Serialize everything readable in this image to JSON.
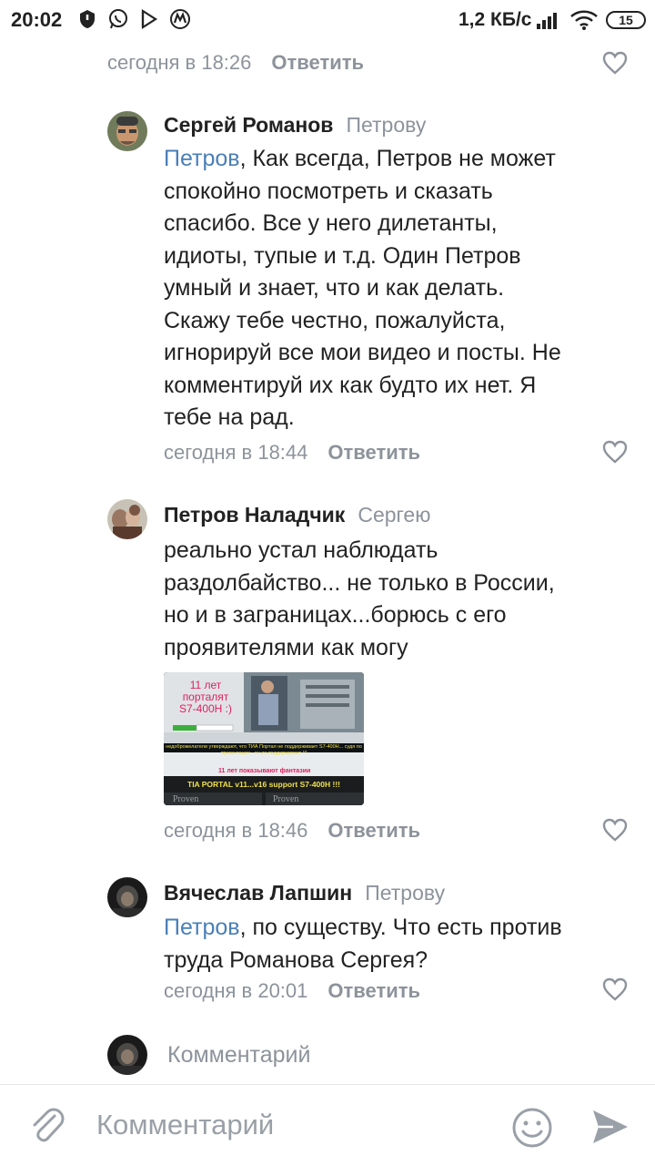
{
  "status_bar": {
    "time": "20:02",
    "net_speed": "1,2 КБ/с",
    "battery": "15"
  },
  "comments": [
    {
      "date": "сегодня в 18:26",
      "reply_label": "Ответить"
    },
    {
      "author": "Сергей Романов",
      "reply_to": "Петрову",
      "mention": "Петров",
      "lines": [
        ", Как всегда, Петров не может",
        "спокойно посмотреть и сказать",
        "спасибо. Все у него дилетанты,",
        "идиоты, тупые и т.д. Один Петров",
        "умный и знает, что и как делать.",
        "Скажу тебе честно, пожалуйста,",
        "игнорируй все мои видео и посты. Не",
        "комментируй их как будто их нет. Я",
        "тебе на рад."
      ],
      "date": "сегодня в 18:44",
      "reply_label": "Ответить"
    },
    {
      "author": "Петров Наладчик",
      "reply_to": "Сергею",
      "lines": [
        "реально устал наблюдать",
        "раздолбайство... не только в России,",
        "но и в заграницах...борюсь с его",
        "проявителями как могу"
      ],
      "attachment": {
        "title_line1": "11 лет",
        "title_line2": "порталят",
        "title_line3": "S7-400H :)",
        "caption_top": "недоброжелатели утверждают, что ТИА Портал не поддерживает S7-400H... судя по презентации - он их поддерживает !!!",
        "caption_mid": "11 лет показывают фантазии",
        "caption_bottom": "TIA PORTAL v11...v16 support S7-400H !!!",
        "tab1": "Proven",
        "tab2": "Proven"
      },
      "date": "сегодня в 18:46",
      "reply_label": "Ответить"
    },
    {
      "author": "Вячеслав Лапшин",
      "reply_to": "Петрову",
      "mention": "Петров",
      "lines": [
        ", по существу. Что есть против",
        "труда Романова Сергея?"
      ],
      "date": "сегодня в 20:01",
      "reply_label": "Ответить"
    }
  ],
  "mini_input_placeholder": "Комментарий",
  "composer": {
    "placeholder": "Комментарий"
  },
  "colors": {
    "accent": "#4a7fb8",
    "muted": "#8d939b",
    "text": "#222222"
  }
}
